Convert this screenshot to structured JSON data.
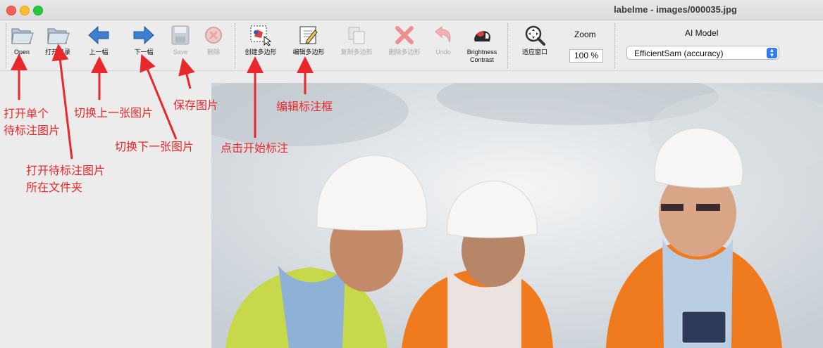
{
  "window": {
    "title": "labelme - images/000035.jpg"
  },
  "toolbar": {
    "open": "Open",
    "open_dir": "打开目录",
    "prev": "上一幅",
    "next": "下一幅",
    "save": "Save",
    "delete": "删除",
    "create_polygon": "创建多边形",
    "edit_polygon": "编辑多边形",
    "copy_polygon": "复制多边形",
    "delete_polygon": "删除多边形",
    "undo": "Undo",
    "brightness": "Brightness\nContrast",
    "fit_window": "适应窗口",
    "zoom_label": "Zoom",
    "zoom_value": "100 %",
    "ai_model_label": "AI Model",
    "ai_model_value": "EfficientSam (accuracy)"
  },
  "annotations": {
    "open_single": "打开单个\n待标注图片",
    "open_dir": "打开待标注图片\n所在文件夹",
    "prev": "切换上一张图片",
    "next": "切换下一张图片",
    "save": "保存图片",
    "create": "点击开始标注",
    "edit": "编辑标注框"
  },
  "colors": {
    "annotation": "#e8282a",
    "select_accent": "#2c7cf5",
    "vest_orange": "#f07a1e",
    "vest_yellow": "#d9e24a",
    "helmet": "#f6f6f6"
  },
  "icons": {
    "open": "folder-open-icon",
    "open_dir": "folder-open-icon",
    "prev": "arrow-left-icon",
    "next": "arrow-right-icon",
    "save": "floppy-disk-icon",
    "delete": "delete-circle-icon",
    "create": "polygon-create-icon",
    "edit": "edit-pencil-icon",
    "copy": "copy-icon",
    "delete_polygon": "red-x-icon",
    "undo": "undo-arrow-icon",
    "brightness": "brightness-contrast-icon",
    "fit": "fit-window-icon"
  }
}
